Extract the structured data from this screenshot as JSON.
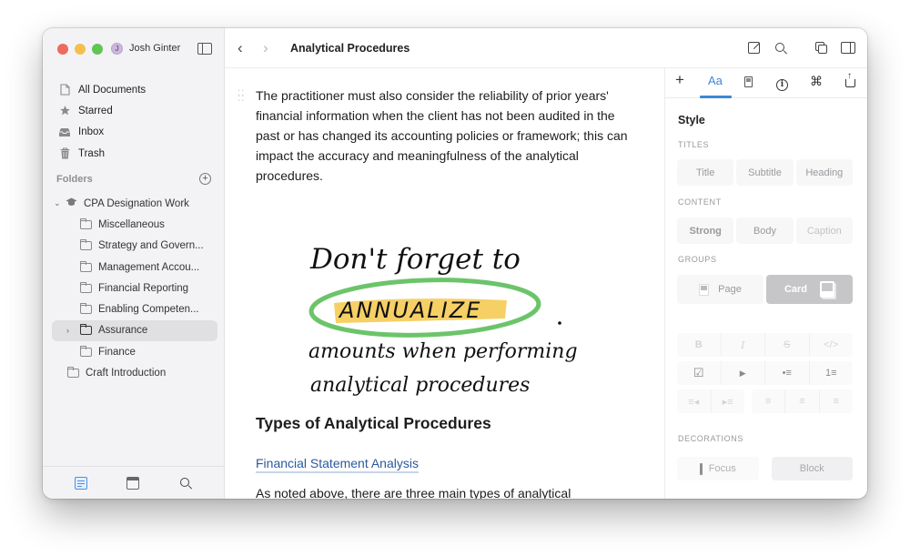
{
  "window": {
    "user": {
      "initial": "J",
      "name": "Josh Ginter"
    }
  },
  "sidebar": {
    "nav_items": [
      {
        "label": "All Documents",
        "icon": "document-icon"
      },
      {
        "label": "Starred",
        "icon": "star-icon"
      },
      {
        "label": "Inbox",
        "icon": "inbox-icon"
      },
      {
        "label": "Trash",
        "icon": "trash-icon"
      }
    ],
    "folders_header": "Folders",
    "folders": [
      {
        "label": "CPA Designation Work",
        "icon": "graduation-cap-icon",
        "expanded": true,
        "level": 0
      },
      {
        "label": "Miscellaneous",
        "icon": "folder-icon",
        "level": 1
      },
      {
        "label": "Strategy and Govern...",
        "icon": "folder-icon",
        "level": 1
      },
      {
        "label": "Management Accou...",
        "icon": "folder-icon",
        "level": 1
      },
      {
        "label": "Financial Reporting",
        "icon": "folder-icon",
        "level": 1
      },
      {
        "label": "Enabling Competen...",
        "icon": "folder-icon",
        "level": 1
      },
      {
        "label": "Assurance",
        "icon": "folder-icon",
        "level": 1,
        "selected": true,
        "collapsed_children": true
      },
      {
        "label": "Finance",
        "icon": "folder-icon",
        "level": 1
      },
      {
        "label": "Craft Introduction",
        "icon": "folder-icon",
        "level": 0
      }
    ],
    "bottom_tabs": [
      "documents-icon",
      "calendar-icon",
      "search-icon"
    ]
  },
  "toolbar": {
    "back": "‹",
    "forward": "›",
    "title": "Analytical Procedures"
  },
  "document": {
    "paragraph1": "The practitioner must also consider the reliability of prior years' financial information when the client has not been audited in the past or has changed its accounting policies or framework; this can impact the accuracy and meaningfulness of the analytical procedures.",
    "sketch": {
      "line1": "Don't forget to",
      "highlight": "ANNUALIZE",
      "line3": "amounts when performing",
      "line4": "analytical procedures",
      "circle_color": "#6cc46a",
      "highlight_color": "#f5c84a"
    },
    "heading": "Types of Analytical Procedures",
    "link": "Financial Statement Analysis",
    "paragraph2": "As noted above, there are three main types of analytical"
  },
  "right_panel": {
    "tabs": [
      {
        "label": "+",
        "name": "insert"
      },
      {
        "label": "Aa",
        "name": "style",
        "active": true
      },
      {
        "label": "",
        "name": "image"
      },
      {
        "label": "i",
        "name": "info"
      },
      {
        "label": "⌘",
        "name": "shortcuts"
      },
      {
        "label": "",
        "name": "share"
      }
    ],
    "style_title": "Style",
    "titles_label": "TITLES",
    "titles": [
      "Title",
      "Subtitle",
      "Heading"
    ],
    "content_label": "CONTENT",
    "content": [
      "Strong",
      "Body",
      "Caption"
    ],
    "groups_label": "GROUPS",
    "groups": [
      {
        "label": "Page",
        "selected": false
      },
      {
        "label": "Card",
        "selected": true
      }
    ],
    "format_row1": [
      "B",
      "I",
      "S",
      "</>"
    ],
    "format_row2": [
      "☑",
      "▶",
      "•≡",
      "1≡"
    ],
    "format_row3a": [
      "≡◂",
      "▸≡"
    ],
    "format_row3b": [
      "≡",
      "≡",
      "≡"
    ],
    "decorations_label": "DECORATIONS",
    "decorations": [
      "Focus",
      "Block"
    ],
    "accent_color": "#3d87d8"
  }
}
